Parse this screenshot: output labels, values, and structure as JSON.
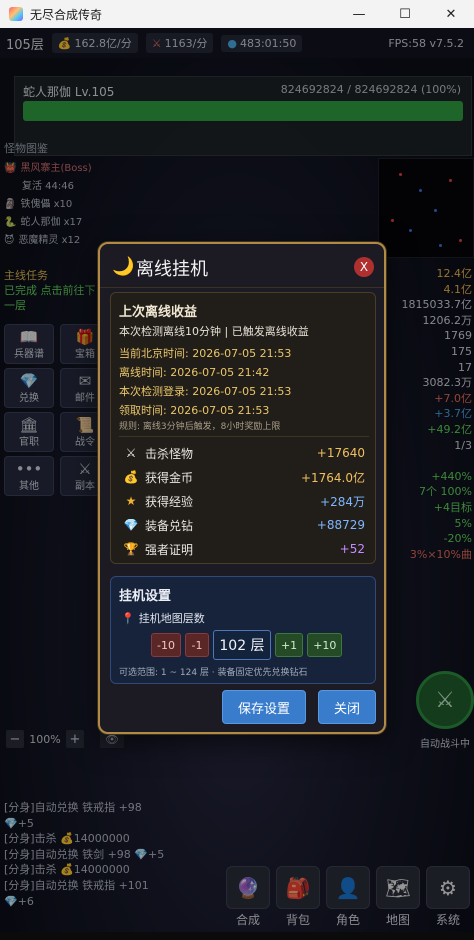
{
  "window": {
    "title": "无尽合成传奇",
    "controls": [
      "—",
      "☐",
      "✕"
    ]
  },
  "topbar": {
    "floor": "105层",
    "gold": "162.8亿",
    "gold_rate": "/分",
    "attack": "1163",
    "attack_rate": "/分",
    "timer": "483:01:50",
    "fps": "FPS:58 v7.5.2"
  },
  "boss": {
    "name": "蛇人那伽 Lv.105",
    "hp": "824692824 / 824692824 (100%)",
    "hp_fraction": 1.0
  },
  "tabs": "怪物图鉴",
  "left_list": [
    {
      "label": "黑风寨主(Boss)",
      "cls": "red"
    },
    {
      "label": "复活 44:46",
      "cls": ""
    },
    {
      "label": "铁傀儡 x10",
      "cls": ""
    },
    {
      "label": "蛇人那伽 x17",
      "cls": ""
    },
    {
      "label": "恶魔精灵 x12",
      "cls": ""
    }
  ],
  "quest": {
    "title": "主线任务",
    "status": "已完成 点击前往下一层"
  },
  "side_buttons": [
    {
      "label": "兵器谱",
      "icon": "📖"
    },
    {
      "label": "宝箱",
      "icon": "🎁"
    },
    {
      "label": "兑换",
      "icon": "💎"
    },
    {
      "label": "邮件",
      "icon": "✉"
    },
    {
      "label": "官职",
      "icon": "🏛"
    },
    {
      "label": "战令",
      "icon": "📜"
    },
    {
      "label": "其他",
      "icon": "•••"
    },
    {
      "label": "副本",
      "icon": "⚔"
    }
  ],
  "right_stats": [
    {
      "t": "12.4亿",
      "c": "o"
    },
    {
      "t": "4.1亿",
      "c": "o"
    },
    {
      "t": "1815033.7亿",
      "c": "w"
    },
    {
      "t": "1206.2万",
      "c": "w"
    },
    {
      "t": "1769",
      "c": "w"
    },
    {
      "t": "175",
      "c": "w"
    },
    {
      "t": "17",
      "c": "w"
    },
    {
      "t": "3082.3万",
      "c": "w"
    },
    {
      "t": "+7.0亿",
      "c": "r"
    },
    {
      "t": "+3.7亿",
      "c": "b"
    },
    {
      "t": "+49.2亿",
      "c": "g"
    },
    {
      "t": "1/3",
      "c": "w"
    },
    {
      "t": "",
      "c": "w"
    },
    {
      "t": "+440%",
      "c": "g"
    },
    {
      "t": "7个 100%",
      "c": "g"
    },
    {
      "t": "+4目标",
      "c": "g"
    },
    {
      "t": "5%",
      "c": "g"
    },
    {
      "t": "-20%",
      "c": "g"
    },
    {
      "t": "3%×10%曲",
      "c": "r"
    }
  ],
  "auto_battle": {
    "label": "自动战斗中",
    "icon": "swords-icon"
  },
  "zoom": {
    "minus": "−",
    "value": "100%",
    "plus": "+",
    "eye": "👁"
  },
  "log": [
    "[分身]自动兑换 铁戒指 +98",
    "💎+5",
    "[分身]击杀 💰14000000",
    "[分身]自动兑换 铁剑 +98 💎+5",
    "[分身]击杀 💰14000000",
    "[分身]自动兑换 铁戒指 +101",
    "💎+6"
  ],
  "bottom_nav": [
    {
      "label": "合成",
      "icon": "🔮"
    },
    {
      "label": "背包",
      "icon": "🎒"
    },
    {
      "label": "角色",
      "icon": "👤"
    },
    {
      "label": "地图",
      "icon": "🗺"
    },
    {
      "label": "系统",
      "icon": "⚙"
    }
  ],
  "modal": {
    "title": "离线挂机",
    "close": "X",
    "earnings": {
      "heading": "上次离线收益",
      "subtitle": "本次检测离线10分钟 | 已触发离线收益",
      "info": [
        "当前北京时间: 2026-07-05 21:53",
        "离线时间: 2026-07-05 21:42",
        "本次检测登录: 2026-07-05 21:53",
        "领取时间: 2026-07-05 21:53"
      ],
      "rule": "规则: 离线3分钟后触发，8小时奖励上限",
      "rows": [
        {
          "icon": "⚔",
          "label": "击杀怪物",
          "value": "+17640",
          "color": "#f0c060"
        },
        {
          "icon": "💰",
          "label": "获得金币",
          "value": "+1764.0亿",
          "color": "#f0c060"
        },
        {
          "icon": "★",
          "label": "获得经验",
          "value": "+284万",
          "color": "#7fb6ff"
        },
        {
          "icon": "💎",
          "label": "装备兑钻",
          "value": "+88729",
          "color": "#7fb6ff"
        },
        {
          "icon": "🏆",
          "label": "强者证明",
          "value": "+52",
          "color": "#c48cff"
        }
      ]
    },
    "idle": {
      "heading": "挂机设置",
      "floor_label": "挂机地图层数",
      "minus10": "-10",
      "minus1": "-1",
      "value": "102 层",
      "plus1": "+1",
      "plus10": "+10",
      "range": "可选范围: 1 ~ 124 层 · 装备固定优先兑换钻石"
    },
    "save": "保存设置",
    "close_btn": "关闭"
  },
  "colors": {
    "modal_border": "#b08a46",
    "primary": "#3a7ccc"
  }
}
